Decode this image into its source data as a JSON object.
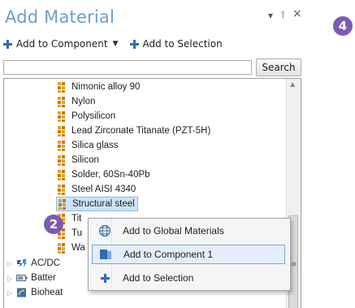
{
  "panel": {
    "title": "Add Material",
    "controls": {
      "menu": "▾",
      "pin": "⊺",
      "close": "×"
    }
  },
  "toolbar": {
    "add_to_component": "Add to Component",
    "add_to_selection": "Add to Selection"
  },
  "search": {
    "value": "",
    "button_label": "Search"
  },
  "tree": {
    "materials": [
      "Nimonic alloy 90",
      "Nylon",
      "Polysilicon",
      "Lead Zirconate Titanate (PZT-5H)",
      "Silica glass",
      "Silicon",
      "Solder, 60Sn-40Pb",
      "Steel AISI 4340",
      "Structural steel",
      "Tit",
      "Tu",
      "Wa"
    ],
    "folders": [
      "AC/DC",
      "Batter",
      "Bioheat"
    ]
  },
  "context_menu": {
    "items": [
      "Add to Global Materials",
      "Add to Component 1",
      "Add to Selection"
    ],
    "highlighted": "Add to Component 1"
  },
  "badges": {
    "step_top": "4",
    "step_menu": "2"
  },
  "colors": {
    "title": "#6d9ec9",
    "badge": "#7d5bb3",
    "accent_plus": "#2e6cb6",
    "material_icon": "#e8a020"
  }
}
